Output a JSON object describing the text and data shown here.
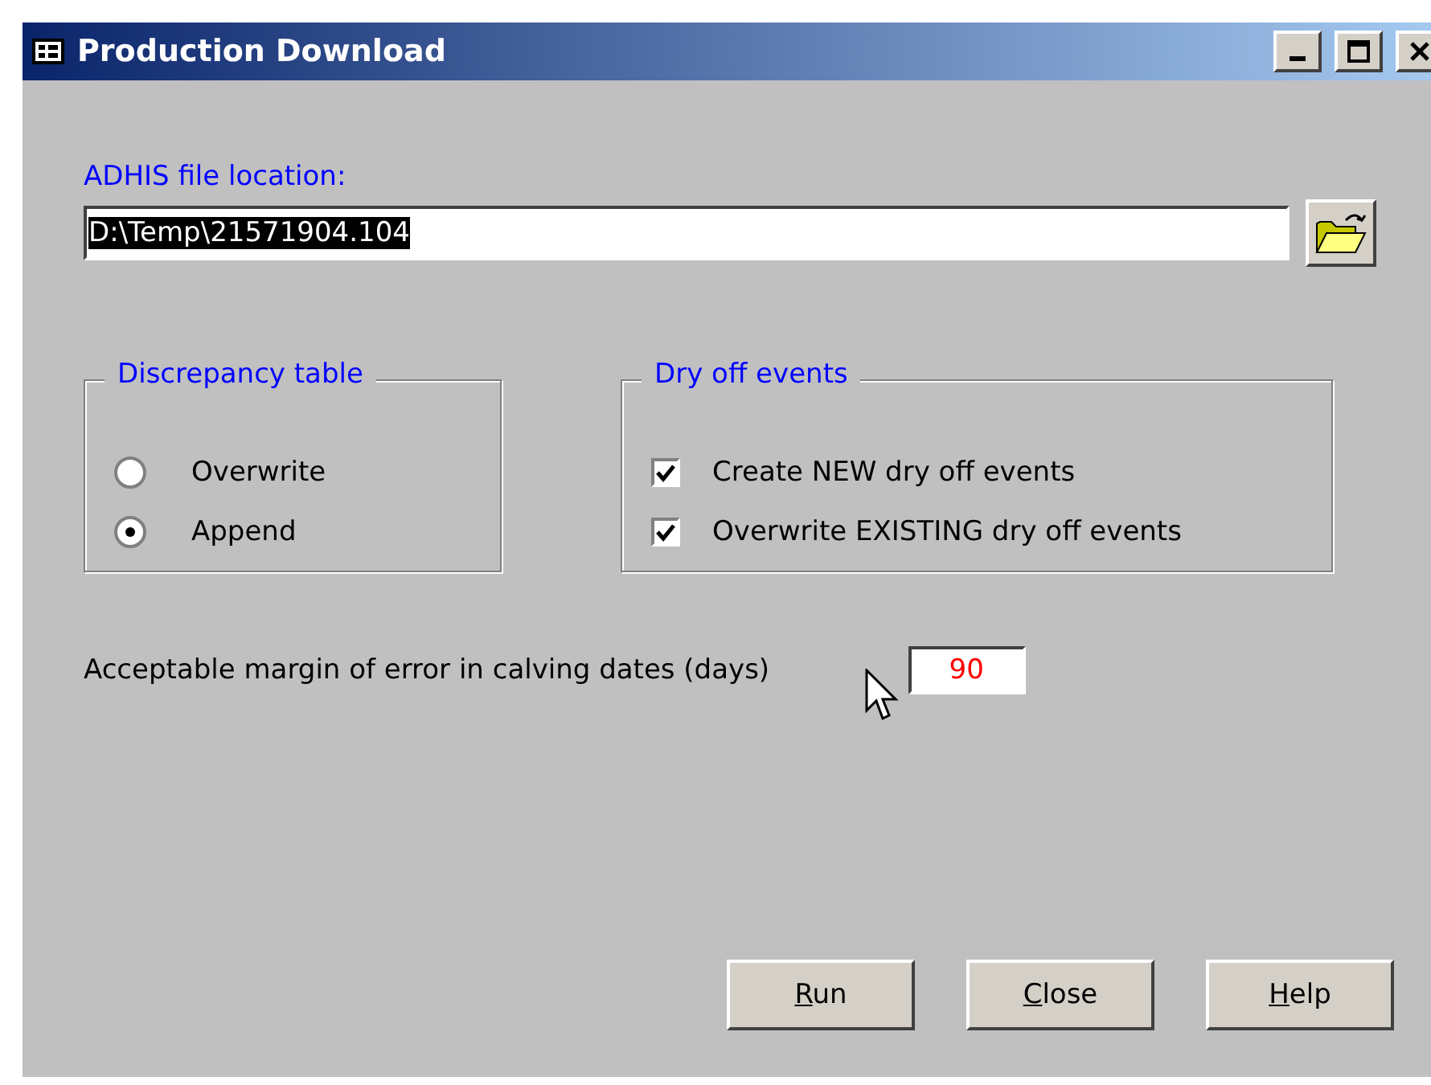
{
  "window": {
    "title": "Production Download"
  },
  "file_location": {
    "label": "ADHIS file location:",
    "value": "D:\\Temp\\21571904.104",
    "selected": true
  },
  "discrepancy_table": {
    "title": "Discrepancy table",
    "options": [
      {
        "label": "Overwrite",
        "selected": false
      },
      {
        "label": "Append",
        "selected": true
      }
    ]
  },
  "dry_off_events": {
    "title": "Dry off events",
    "options": [
      {
        "label": "Create NEW dry off events",
        "checked": true
      },
      {
        "label": "Overwrite EXISTING dry off events",
        "checked": true
      }
    ]
  },
  "margin": {
    "label": "Acceptable margin of error in calving dates (days)",
    "value": "90"
  },
  "buttons": [
    "Run",
    "Close",
    "Help"
  ]
}
